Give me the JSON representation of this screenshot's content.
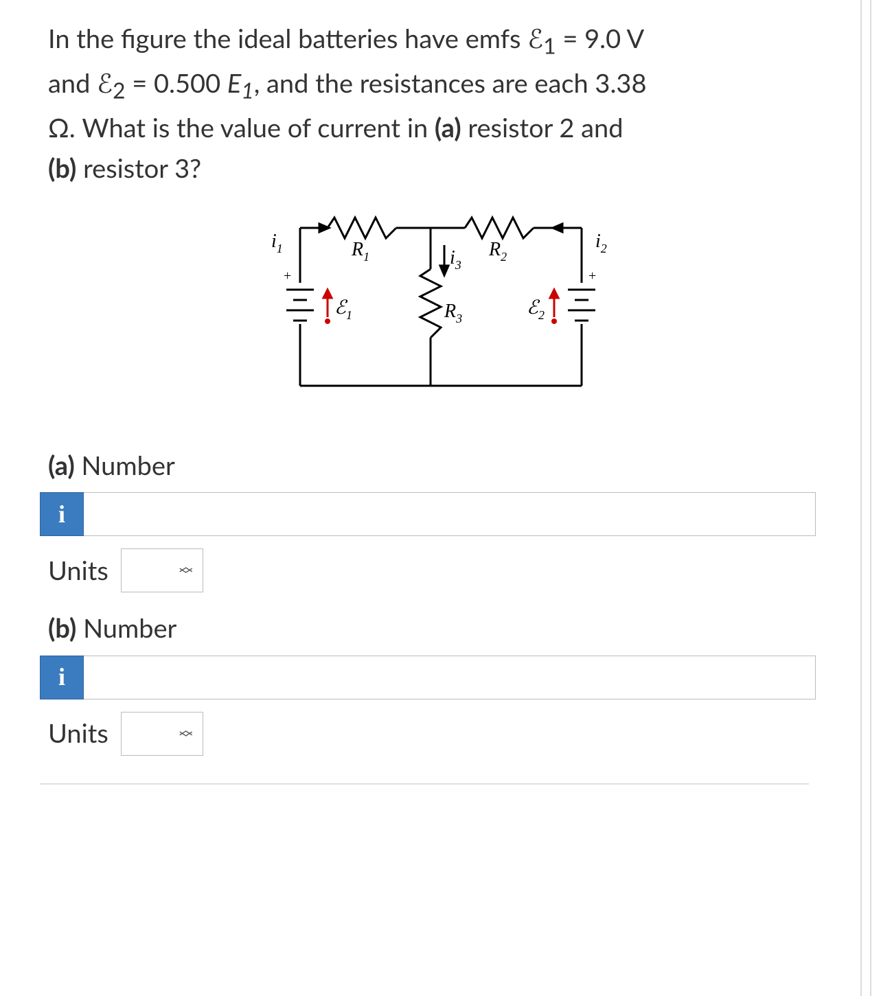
{
  "question": {
    "line1_pre": "In the figure the ideal batteries have emfs ",
    "emf1_sym": "ℰ",
    "emf1_sub": "1",
    "eq": " = ",
    "emf1_val": "9.0 V",
    "line2_pre": "and ",
    "emf2_sym": "ℰ",
    "emf2_sub": "2",
    "emf2_eq": " = 0.500 ",
    "e1_sym": "E",
    "e1_sub": "1",
    "line2_post": ", and the resistances are each 3.38",
    "line3_pre": "Ω. What is the value of current in ",
    "part_a_tag": "(a)",
    "line3_mid": " resistor 2 and",
    "part_b_tag": "(b)",
    "line4": " resistor 3?"
  },
  "circuit": {
    "i1": "i",
    "i1_sub": "1",
    "i2": "i",
    "i2_sub": "2",
    "i3": "i",
    "i3_sub": "3",
    "R1": "R",
    "R1_sub": "1",
    "R2": "R",
    "R2_sub": "2",
    "R3": "R",
    "R3_sub": "3",
    "E1": "ℰ",
    "E1_sub": "1",
    "E2": "ℰ",
    "E2_sub": "2",
    "plus": "+"
  },
  "parts": {
    "a": {
      "tag": "(a)",
      "label": "Number",
      "units_label": "Units"
    },
    "b": {
      "tag": "(b)",
      "label": "Number",
      "units_label": "Units"
    }
  },
  "info_glyph": "i"
}
